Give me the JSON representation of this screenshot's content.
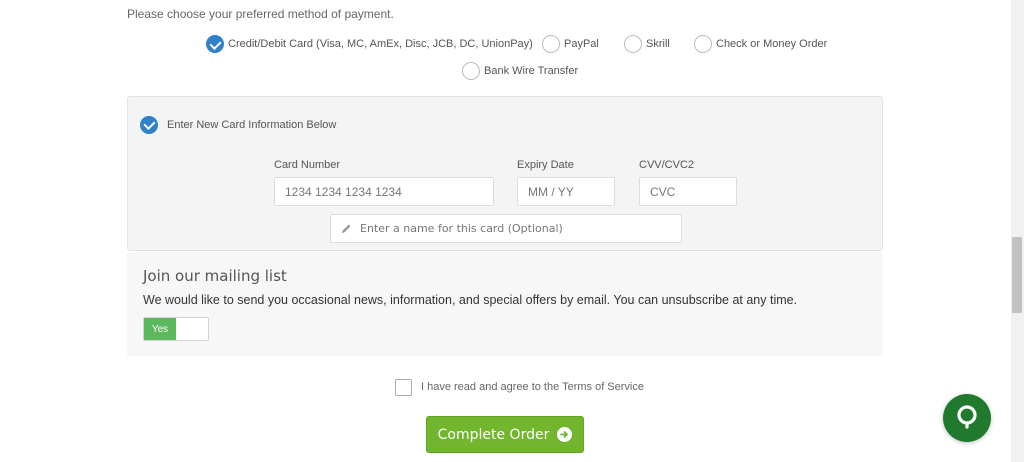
{
  "payment": {
    "intro": "Please choose your preferred method of payment.",
    "options": [
      {
        "label": "Credit/Debit Card (Visa, MC, AmEx, Disc, JCB, DC, UnionPay)",
        "checked": true
      },
      {
        "label": "PayPal",
        "checked": false
      },
      {
        "label": "Skrill",
        "checked": false
      },
      {
        "label": "Check or Money Order",
        "checked": false
      },
      {
        "label": "Bank Wire Transfer",
        "checked": false
      }
    ]
  },
  "card": {
    "new_card_label": "Enter New Card Information Below",
    "number_label": "Card Number",
    "number_placeholder": "1234 1234 1234 1234",
    "expiry_label": "Expiry Date",
    "expiry_placeholder": "MM / YY",
    "cvv_label": "CVV/CVC2",
    "cvv_placeholder": "CVC",
    "name_placeholder": "Enter a name for this card (Optional)"
  },
  "mailing": {
    "title": "Join our mailing list",
    "text": "We would like to send you occasional news, information, and special offers by email. You can unsubscribe at any time.",
    "toggle_label": "Yes"
  },
  "tos": {
    "text": "I have read and agree to the Terms of Service"
  },
  "order": {
    "button_label": "Complete Order"
  },
  "icons": {
    "check": "check-icon",
    "pencil": "pencil-icon",
    "arrow": "arrow-right-circle-icon",
    "chat": "chat-icon"
  },
  "colors": {
    "accent_blue": "#2f82c8",
    "toggle_green": "#5cb85c",
    "button_green": "#71b62d",
    "chat_green": "#1f7a2e"
  }
}
